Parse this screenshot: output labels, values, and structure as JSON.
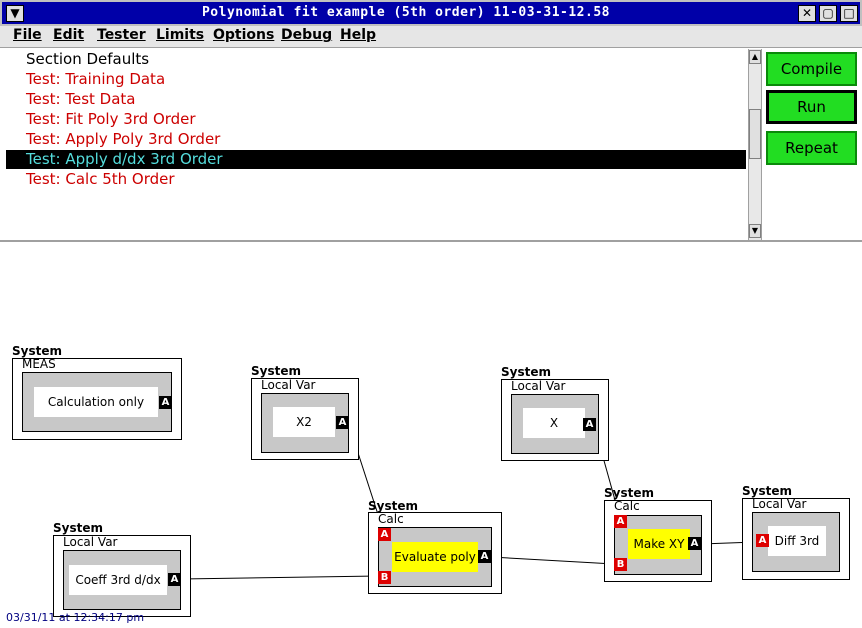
{
  "window": {
    "title": "Polynomial fit example (5th order) 11-03-31-12.58",
    "menu_glyph": "▼",
    "minimize_glyph": "▢",
    "maximize_glyph": "□",
    "close_glyph": "✕"
  },
  "menu": [
    "File",
    "Edit",
    "Tester",
    "Limits",
    "Options",
    "Debug",
    "Help"
  ],
  "list": {
    "items": [
      {
        "label": "Section Defaults",
        "color": "#000000",
        "selected": false
      },
      {
        "label": "Test: Training Data",
        "color": "#cc0000",
        "selected": false
      },
      {
        "label": "Test: Test Data",
        "color": "#cc0000",
        "selected": false
      },
      {
        "label": "Test: Fit Poly 3rd Order",
        "color": "#cc0000",
        "selected": false
      },
      {
        "label": "Test: Apply Poly 3rd Order",
        "color": "#cc0000",
        "selected": false
      },
      {
        "label": "Test: Apply d/dx 3rd Order",
        "color": "#55dddd",
        "selected": true
      },
      {
        "label": "Test: Calc 5th Order",
        "color": "#cc0000",
        "selected": false
      }
    ],
    "up_glyph": "▲",
    "down_glyph": "▼"
  },
  "buttons": {
    "compile": "Compile",
    "run": "Run",
    "repeat": "Repeat"
  },
  "nodes": {
    "n1": {
      "system": "System",
      "sub": "MEAS",
      "name": "Calculation only",
      "out": "A"
    },
    "n2": {
      "system": "System",
      "sub": "Local Var",
      "name": "X2",
      "out": "A"
    },
    "n3": {
      "system": "System",
      "sub": "Local Var",
      "name": "X",
      "out": "A"
    },
    "n4": {
      "system": "System",
      "sub": "Local Var",
      "name": "Coeff 3rd d/dx",
      "out": "A"
    },
    "n5": {
      "system": "System",
      "sub": "Calc",
      "name": "Evaluate poly",
      "in_a": "A",
      "in_b": "B",
      "out": "A"
    },
    "n6": {
      "system": "System",
      "sub": "Calc",
      "name": "Make XY",
      "in_a": "A",
      "in_b": "B",
      "out": "A"
    },
    "n7": {
      "system": "System",
      "sub": "Local Var",
      "name": "Diff 3rd",
      "in_a": "A"
    }
  },
  "status": {
    "timestamp": "03/31/11 at 12:34:17 pm"
  },
  "colors": {
    "title_bg": "#0000a8",
    "button_green": "#22dd22",
    "test_red": "#cc0000",
    "selected_text": "#55dddd",
    "calc_yellow": "#ffff00",
    "input_port": "#dd0000"
  }
}
